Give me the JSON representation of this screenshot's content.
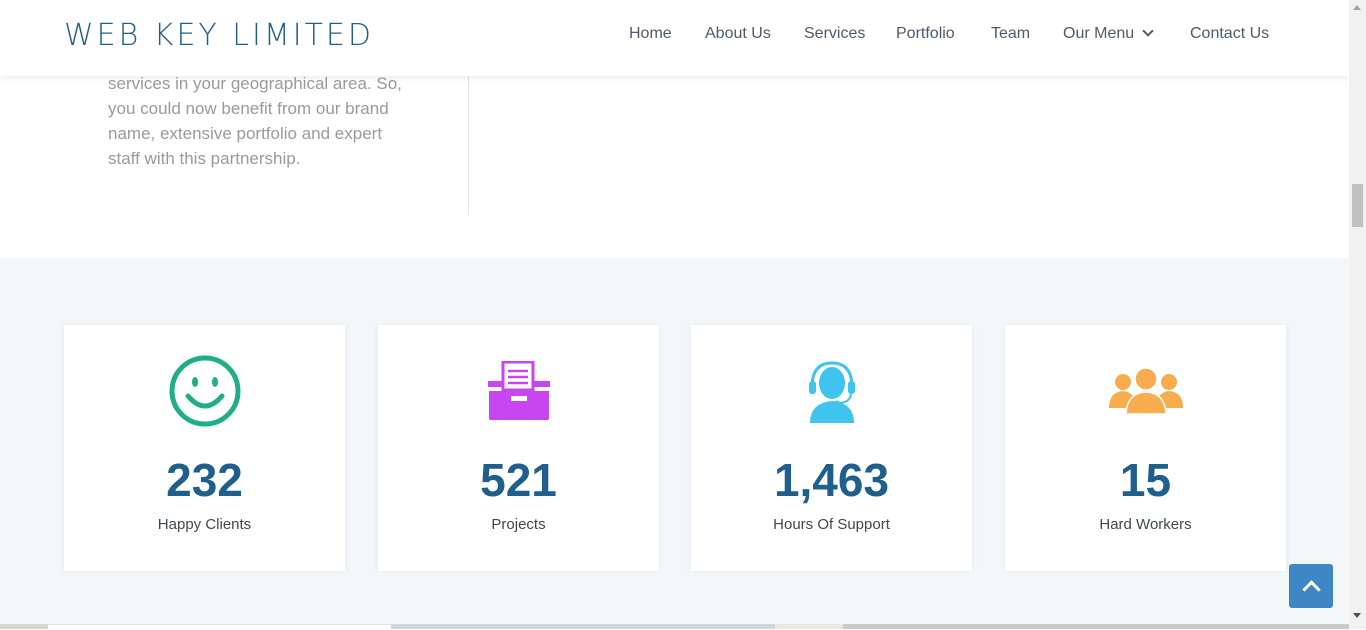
{
  "header": {
    "brand": "WEB KEY LIMITED",
    "nav": [
      "Home",
      "About Us",
      "Services",
      "Portfolio",
      "Team",
      "Our Menu",
      "Contact Us"
    ]
  },
  "about": {
    "lines": [
      "services in your geographical area. So,",
      "you could now benefit from our brand",
      "name, extensive portfolio and expert",
      "staff with this partnership."
    ]
  },
  "counters": [
    {
      "icon": "smiley-face-icon",
      "color": "#1fad8a",
      "number": "232",
      "label": "Happy Clients"
    },
    {
      "icon": "folder-icon",
      "color": "#c846ef",
      "number": "521",
      "label": "Projects"
    },
    {
      "icon": "support-agent-icon",
      "color": "#3ec4ee",
      "number": "1,463",
      "label": "Hours Of Support"
    },
    {
      "icon": "team-icon",
      "color": "#f8ac4d",
      "number": "15",
      "label": "Hard Workers"
    }
  ],
  "colors": {
    "brand": "#1f5f8b",
    "accent": "#3e86c6",
    "section_bg": "#f3f7fa"
  }
}
